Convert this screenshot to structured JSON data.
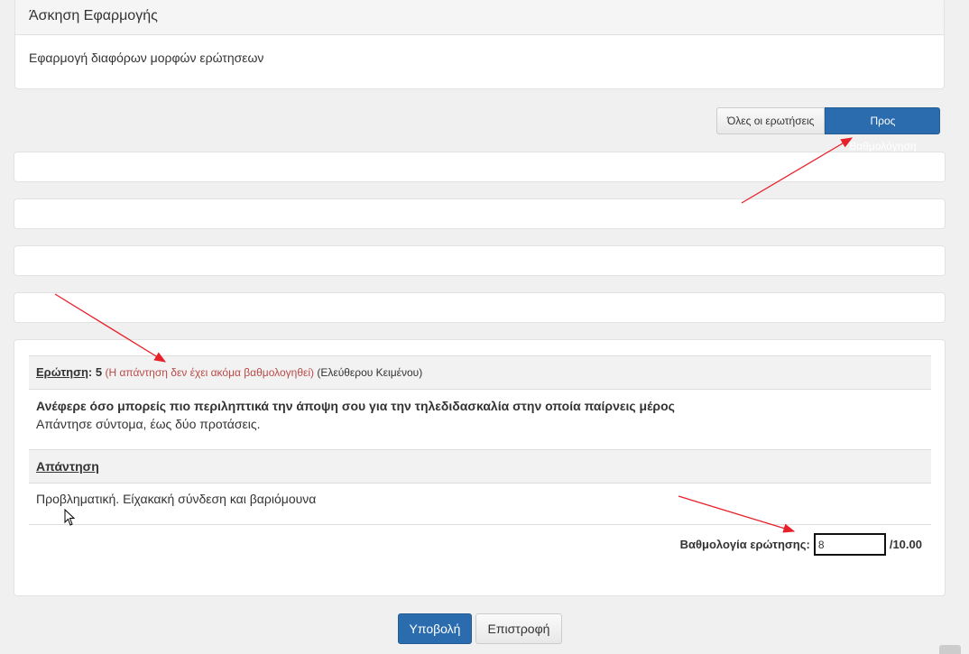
{
  "exercise": {
    "title": "Άσκηση Εφαρμογής",
    "description": "Εφαρμογή διαφόρων μορφών ερώτησεων"
  },
  "filters": {
    "all_questions": "Όλες οι ερωτήσεις",
    "to_grade": "Προς Βαθμολόγηση"
  },
  "question": {
    "label": "Ερώτηση",
    "number": "5",
    "status": "(Η απάντηση δεν έχει ακόμα βαθμολογηθεί)",
    "type": "(Ελεύθερου Κειμένου)",
    "text": "Ανέφερε όσο μπορείς πιο περιληπτικά την άποψη σου για την τηλεδιδασκαλία στην οποία παίρνεις μέρος",
    "hint": "Απάντησε σύντομα, έως δύο προτάσεις.",
    "answer_label": "Απάντηση",
    "answer_text": "Προβληματική. Είχακακή σύνδεση και βαριόμουνα",
    "score_label": "Βαθμολογία ερώτησης:",
    "score_value": "8",
    "score_max": "/10.00"
  },
  "actions": {
    "submit": "Υποβολή",
    "back": "Επιστροφή"
  },
  "colors": {
    "primary": "#2a6cad",
    "warning": "#b94a48",
    "annotation_arrow": "#e8202a"
  }
}
